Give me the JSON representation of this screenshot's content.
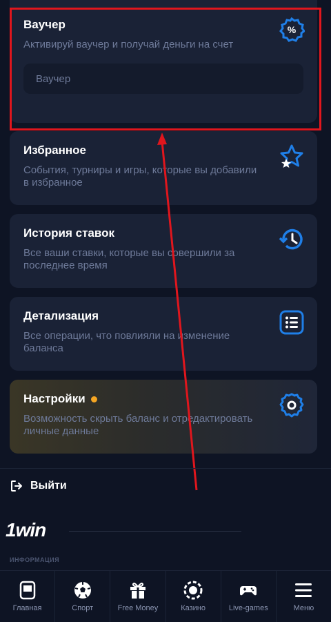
{
  "cards": {
    "voucher": {
      "title": "Ваучер",
      "desc": "Активируй ваучер и получай деньги на счет",
      "input_placeholder": "Ваучер",
      "icon": "percent-badge-icon"
    },
    "favorites": {
      "title": "Избранное",
      "desc": "События, турниры и игры, которые вы добавили в избранное",
      "icon": "star-icon"
    },
    "history": {
      "title": "История ставок",
      "desc": "Все ваши ставки, которые вы совершили за последнее время",
      "icon": "history-clock-icon"
    },
    "details": {
      "title": "Детализация",
      "desc": "Все операции, что повлияли на изменение баланса",
      "icon": "list-icon"
    },
    "settings": {
      "title": "Настройки",
      "desc": "Возможность скрыть баланс и отредактировать личные данные",
      "icon": "gear-icon"
    }
  },
  "logout_label": "Выйти",
  "brand": "1win",
  "info_label": "ИНФОРМАЦИЯ",
  "nav": [
    {
      "label": "Главная",
      "icon": "home-icon"
    },
    {
      "label": "Спорт",
      "icon": "soccer-ball-icon"
    },
    {
      "label": "Free Money",
      "icon": "gift-icon"
    },
    {
      "label": "Казино",
      "icon": "casino-chip-icon"
    },
    {
      "label": "Live-games",
      "icon": "gamepad-icon"
    },
    {
      "label": "Меню",
      "icon": "menu-icon"
    }
  ],
  "colors": {
    "accent_blue": "#1f7fe8",
    "highlight_red": "#e0161d",
    "dot_orange": "#f5a623",
    "bg": "#0e1424"
  }
}
